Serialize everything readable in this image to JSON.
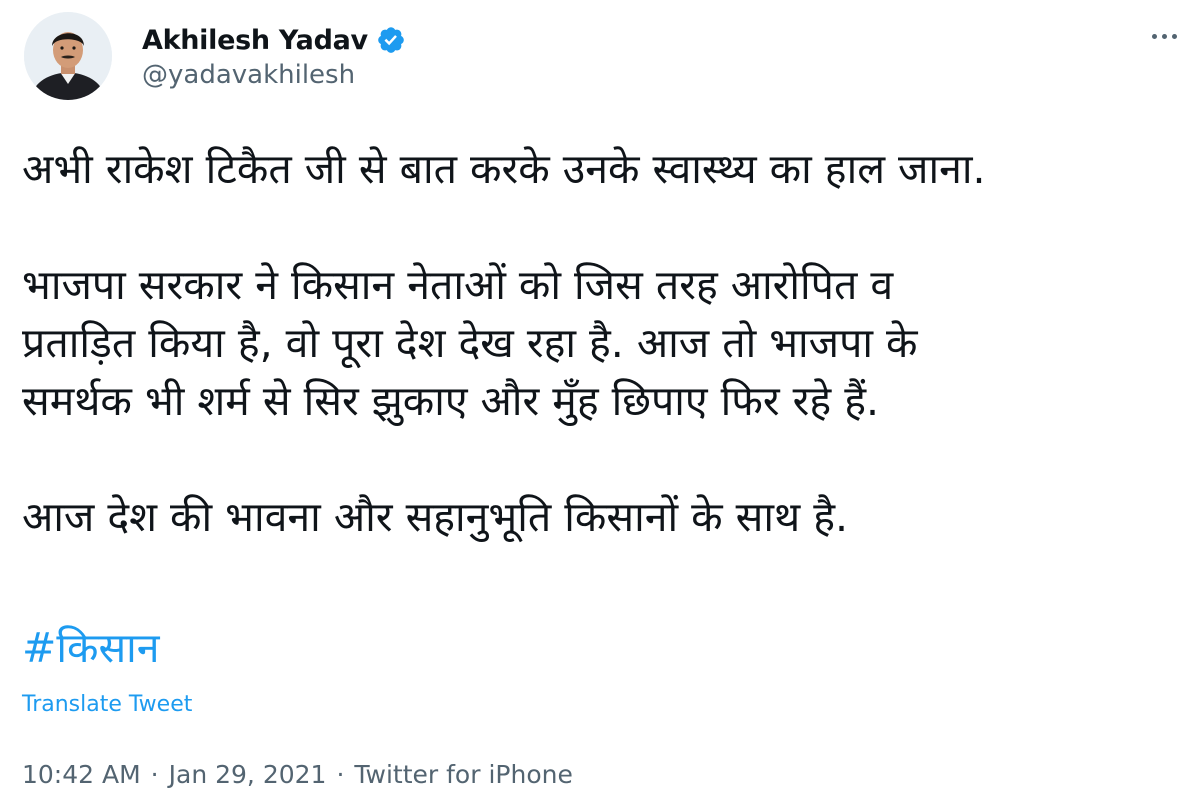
{
  "author": {
    "name": "Akhilesh Yadav",
    "handle": "@yadavakhilesh",
    "verified": true
  },
  "more_icon": "more-horizontal-icon",
  "tweet": {
    "lines": [
      "अभी राकेश टिकैत जी से बात करके उनके स्वास्थ्य का हाल जाना.",
      "",
      "भाजपा सरकार ने किसान नेताओं को जिस तरह आरोपित व",
      "प्रताड़ित किया है, वो पूरा देश देख रहा है. आज तो भाजपा के",
      "समर्थक भी शर्म से सिर झुकाए और मुँह छिपाए फिर रहे हैं.",
      "",
      "आज देश की भावना और सहानुभूति किसानों के साथ है."
    ],
    "hashtag": "#किसान",
    "translate_label": "Translate Tweet"
  },
  "meta": {
    "time": "10:42 AM",
    "separator": "·",
    "date": "Jan 29, 2021",
    "source": "Twitter for iPhone"
  },
  "colors": {
    "text": "#0f1419",
    "secondary": "#536471",
    "link": "#1d9bf0",
    "verified_badge": "#1d9bf0"
  }
}
